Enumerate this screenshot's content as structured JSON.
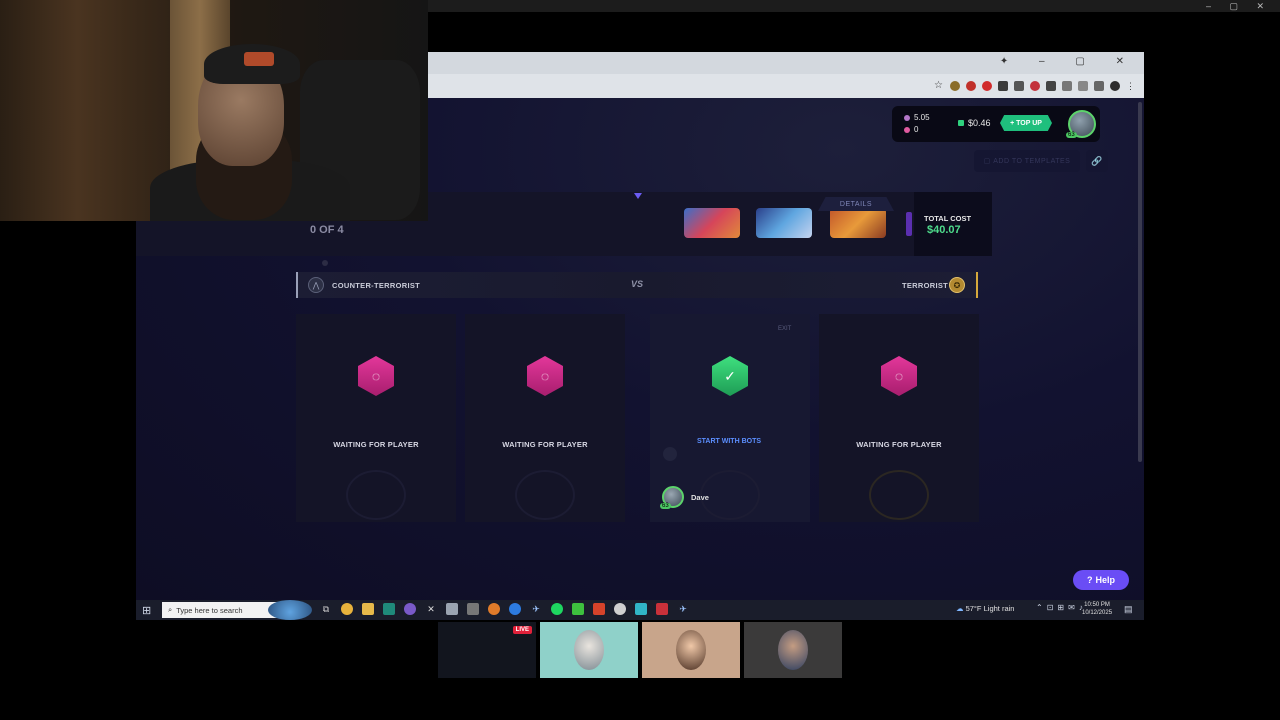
{
  "wallet": {
    "stat1": "5.05",
    "stat2": "0",
    "balance": "$0.46",
    "topup_label": "TOP UP",
    "level": "63"
  },
  "toolbar": {
    "add_templates_label": "ADD TO TEMPLATES"
  },
  "lobby": {
    "count": "0 OF 4",
    "details_label": "DETAILS",
    "total_cost_label": "TOTAL COST",
    "total_cost_value": "$40.07"
  },
  "teams": {
    "ct_label": "COUNTER-TERRORIST",
    "vs_label": "VS",
    "t_label": "TERRORIST"
  },
  "slots": [
    {
      "status": "WAITING FOR PLAYER"
    },
    {
      "status": "WAITING FOR PLAYER"
    },
    {
      "status": "START WITH BOTS",
      "exit_label": "EXIT",
      "player_name": "Dave",
      "player_level": "63"
    },
    {
      "status": "WAITING FOR PLAYER"
    }
  ],
  "help_label": "Help",
  "taskbar": {
    "search_placeholder": "Type here to search",
    "weather": "57°F  Light rain",
    "time": "10:50 PM",
    "date": "10/12/2025"
  },
  "stream": {
    "live_badge": "LIVE"
  },
  "colors": {
    "accent_green": "#4fdc8c",
    "waiting_pink": "#e3379a",
    "help_purple": "#6a4df5",
    "terrorist_gold": "#d6a93c"
  }
}
